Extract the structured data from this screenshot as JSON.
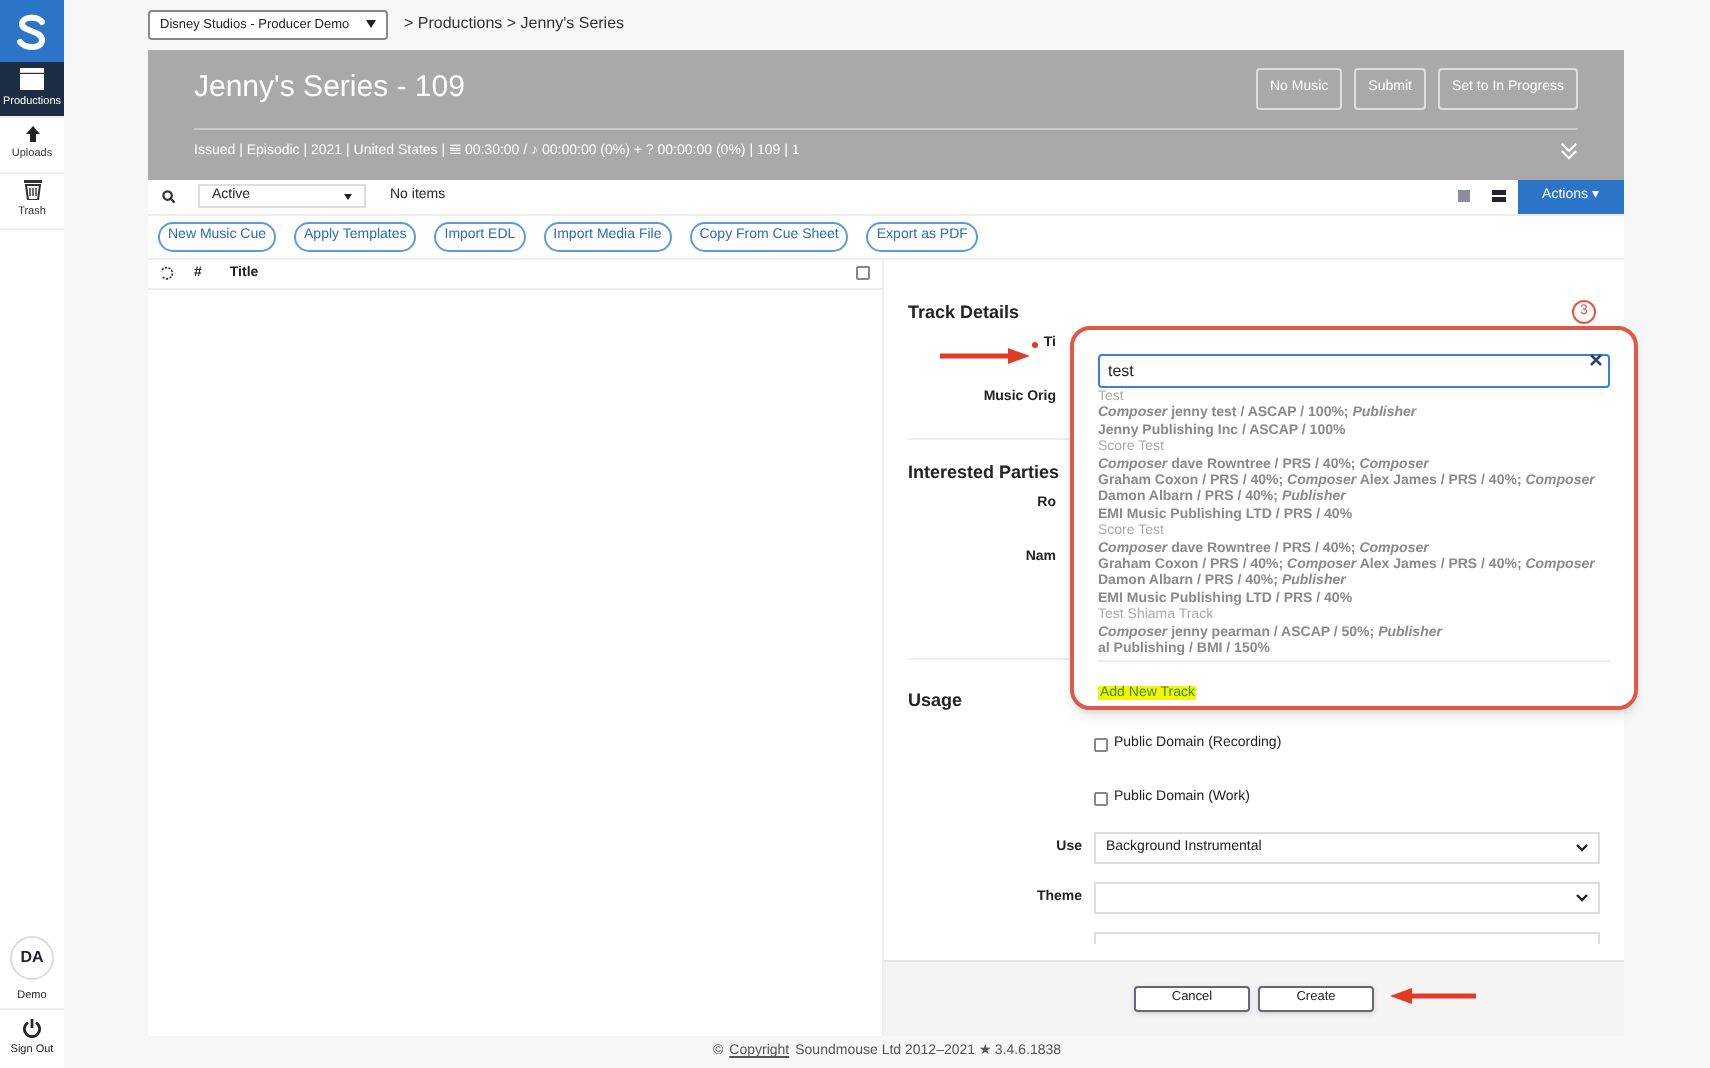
{
  "sidebar": {
    "items": [
      {
        "kind": "productions",
        "label": "Productions",
        "selected": true
      },
      {
        "kind": "uploads",
        "label": "Uploads",
        "selected": false
      },
      {
        "kind": "trash",
        "label": "Trash",
        "selected": false
      }
    ],
    "user": {
      "initials": "DA",
      "label": "Demo"
    },
    "sign_out": "Sign Out"
  },
  "breadcrumb": {
    "company": "Disney Studios - Producer Demo",
    "path": "> Productions > Jenny's Series"
  },
  "header": {
    "title": "Jenny's Series - 109",
    "buttons": [
      "No Music",
      "Submit",
      "Set to In Progress"
    ],
    "meta": "Issued | Episodic | 2021 | United States | 𝌆 00:30:00 / ♪  00:00:00 (0%) + ?  00:00:00 (0%) | 109 | 1"
  },
  "toolbar": {
    "filter": "Active",
    "count": "No items",
    "actions": "Actions ▾"
  },
  "toolbar_buttons": [
    "New Music Cue",
    "Apply Templates",
    "Import EDL",
    "Import Media File",
    "Copy From Cue Sheet",
    "Export as PDF"
  ],
  "table": {
    "columns": [
      "#",
      "Title"
    ],
    "select_all_checked": false
  },
  "track_details": {
    "heading": "Track Details",
    "labels": [
      "Ti",
      "Music Orig"
    ]
  },
  "interested_parties": {
    "heading": "Interested Parties",
    "labels": [
      "Ro",
      "Nam"
    ]
  },
  "step_badge": "3",
  "search_popup": {
    "value": "test",
    "results": [
      {
        "title": "Test",
        "lines": [
          "*Composer* jenny test / ASCAP / 100%; *Publisher*",
          "Jenny Publishing Inc / ASCAP / 100%"
        ]
      },
      {
        "title": "Score Test",
        "lines": [
          "*Composer* dave Rowntree / PRS / 40%; *Composer*",
          "Graham Coxon / PRS / 40%; *Composer* Alex James / PRS / 40%; *Composer*",
          "Damon Albarn / PRS / 40%; *Publisher*",
          "EMI Music Publishing LTD / PRS / 40%"
        ]
      },
      {
        "title": "Score Test",
        "lines": [
          "*Composer* dave Rowntree / PRS / 40%; *Composer*",
          "Graham Coxon / PRS / 40%; *Composer* Alex James / PRS / 40%; *Composer*",
          "Damon Albarn / PRS / 40%; *Publisher*",
          "EMI Music Publishing LTD / PRS / 40%"
        ]
      },
      {
        "title": "Test Shiama Track",
        "lines": [
          "*Composer* jenny pearman / ASCAP / 50%; *Publisher*",
          "al Publishing / BMI / 150%"
        ]
      }
    ],
    "add_new": "Add New Track"
  },
  "usage": {
    "heading": "Usage",
    "checkboxes": [
      {
        "label": "Public Domain (Recording)",
        "checked": false
      },
      {
        "label": "Public Domain (Work)",
        "checked": false
      }
    ],
    "selects": [
      {
        "label": "Use",
        "value": "Background Instrumental"
      },
      {
        "label": "Theme"
      }
    ]
  },
  "footer_buttons": [
    "Cancel",
    "Create"
  ],
  "footer": {
    "prefix": "©",
    "link": "Copyright",
    "text": "Soundmouse Ltd 2012–2021 ★ 3.4.6.1838"
  }
}
